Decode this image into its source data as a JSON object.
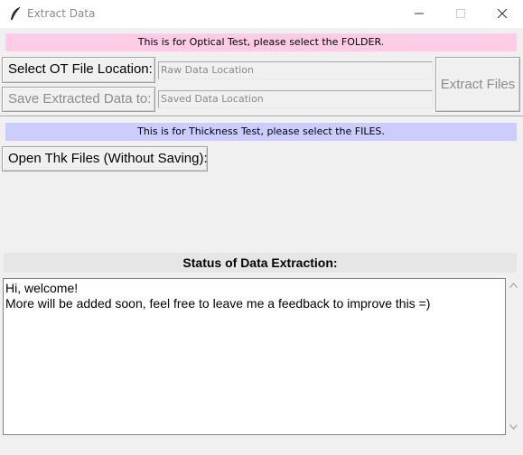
{
  "window": {
    "title": "Extract Data",
    "app_icon": "feather-icon",
    "controls": [
      "minimize-icon",
      "maximize-icon",
      "close-icon"
    ]
  },
  "optical": {
    "banner": "This is for Optical Test, please select the FOLDER.",
    "banner_color": "#ffcce6",
    "select_button": "Select OT File Location:",
    "save_button": "Save Extracted Data to:",
    "raw_location_placeholder": "Raw Data Location",
    "saved_location_placeholder": "Saved Data Location",
    "extract_button": "Extract Files"
  },
  "thickness": {
    "banner": "This is for Thickness Test, please select the FILES.",
    "banner_color": "#ccccff",
    "open_button": "Open Thk Files (Without Saving):"
  },
  "status": {
    "title": "Status of Data Extraction:",
    "lines": [
      "Hi, welcome!",
      "More will be added soon, feel free to leave me a feedback to improve this =)"
    ]
  },
  "scrollbar": {
    "up_icon": "chevron-up-icon",
    "down_icon": "chevron-down-icon"
  }
}
